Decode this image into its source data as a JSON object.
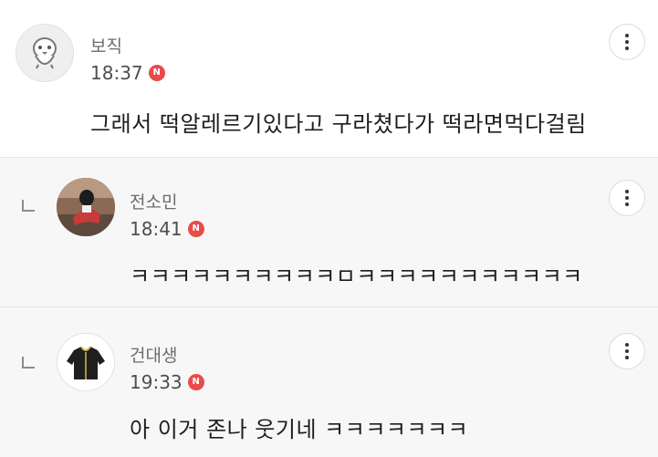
{
  "comments": [
    {
      "nickname": "보직",
      "time": "18:37",
      "badge": "N",
      "text": "그래서 떡알레르기있다고 구라쳤다가 떡라면먹다걸림",
      "is_reply": false
    },
    {
      "nickname": "전소민",
      "time": "18:41",
      "badge": "N",
      "text": "ㅋㅋㅋㅋㅋㅋㅋㅋㅋㅋㅁㅋㅋㅋㅋㅋㅋㅋㅋㅋㅋㅋ",
      "is_reply": true
    },
    {
      "nickname": "건대생",
      "time": "19:33",
      "badge": "N",
      "text": "아 이거 존나 웃기네 ㅋㅋㅋㅋㅋㅋㅋ",
      "is_reply": true
    }
  ],
  "colors": {
    "badge_red": "#e94b4b",
    "reply_background": "#f7f7f7",
    "nickname_gray": "#6c6c6c"
  },
  "icons": {
    "more": "vertical-ellipsis-icon",
    "reply": "reply-arrow-icon",
    "new": "new-badge-icon"
  }
}
